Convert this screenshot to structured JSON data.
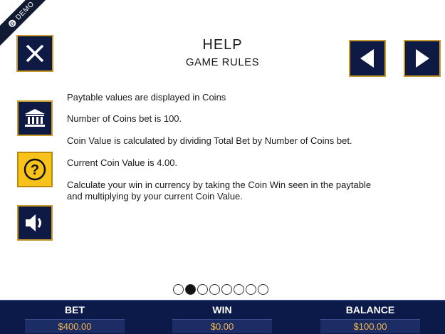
{
  "ribbon": {
    "label": "DEMO"
  },
  "header": {
    "title": "HELP",
    "subtitle": "GAME RULES"
  },
  "rules": [
    "Paytable values are displayed in Coins",
    "Number of Coins bet is 100.",
    "Coin Value is calculated by dividing Total Bet by Number of Coins bet.",
    "Current Coin Value is 4.00.",
    "Calculate your win in currency by taking the Coin Win seen in the paytable and multiplying by your current Coin Value."
  ],
  "pager": {
    "total": 8,
    "current": 2
  },
  "footer": {
    "bet": {
      "label": "BET",
      "value": "$400.00"
    },
    "win": {
      "label": "WIN",
      "value": "$0.00"
    },
    "balance": {
      "label": "BALANCE",
      "value": "$100.00"
    }
  },
  "colors": {
    "navy": "#0e1a44",
    "gold_border": "#c79a2e",
    "help_yellow": "#f7c21a",
    "value_text": "#f2b84a"
  },
  "icons": {
    "close": "close-icon",
    "prev": "triangle-left-icon",
    "next": "triangle-right-icon",
    "paytable": "bank-icon",
    "help": "question-icon",
    "sound": "speaker-icon"
  }
}
